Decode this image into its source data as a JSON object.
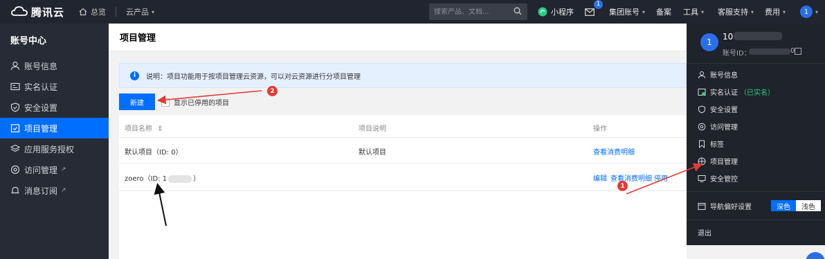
{
  "topnav": {
    "logo_text": "腾讯云",
    "home_label": "总览",
    "products_label": "云产品",
    "search_placeholder": "搜索产品、文档...",
    "mini_program": "小程序",
    "message_badge": "1",
    "group_account": "集团账号",
    "beian": "备案",
    "tools": "工具",
    "support": "客服支持",
    "billing": "费用",
    "avatar": "1"
  },
  "sidebar": {
    "title": "账号中心",
    "items": [
      {
        "label": "账号信息"
      },
      {
        "label": "实名认证"
      },
      {
        "label": "安全设置"
      },
      {
        "label": "项目管理"
      },
      {
        "label": "应用服务授权"
      },
      {
        "label": "访问管理"
      },
      {
        "label": "消息订阅"
      }
    ]
  },
  "main": {
    "page_title": "项目管理",
    "notice": "说明：项目功能用于按项目管理云资源，可以对云资源进行分项目管理",
    "new_button": "新建",
    "show_disabled": "显示已停用的项目",
    "table": {
      "headers": [
        "项目名称",
        "项目说明",
        "操作"
      ],
      "sort_icon": "⇕",
      "rows": [
        {
          "name": "默认项目（ID: 0）",
          "desc": "默认项目",
          "actions": [
            "查看消费明细"
          ]
        },
        {
          "name_prefix": "zoero（ID: 1",
          "name_suffix": "）",
          "desc": "",
          "actions": [
            "编辑",
            "查看消费明细",
            "停用"
          ]
        }
      ]
    }
  },
  "dropdown": {
    "avatar": "1",
    "name_prefix": "100",
    "id_label": "账号ID：",
    "id_suffix": "0",
    "items": [
      {
        "label": "账号信息"
      },
      {
        "label": "实名认证",
        "extra": "（已实名）"
      },
      {
        "label": "安全设置"
      },
      {
        "label": "访问管理"
      },
      {
        "label": "标签"
      },
      {
        "label": "项目管理"
      },
      {
        "label": "安全管控"
      }
    ],
    "nav_pref": "导航偏好设置",
    "theme_dark": "深色",
    "theme_light": "浅色",
    "logout": "退出"
  },
  "annotations": {
    "mark1": "1",
    "mark2": "2"
  },
  "colors": {
    "accent": "#006eff",
    "nav_bg": "#21252f",
    "sidebar_bg": "#262b35",
    "annotation": "#e53935"
  }
}
